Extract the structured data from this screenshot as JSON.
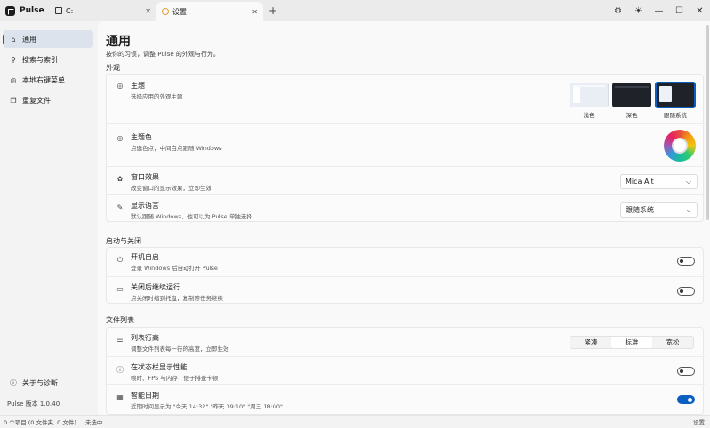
{
  "app": {
    "name": "Pulse"
  },
  "tabs": [
    {
      "label": "C:",
      "icon": "folder-icon",
      "close": "✕"
    },
    {
      "label": "设置",
      "icon": "gear-icon",
      "close": "✕"
    }
  ],
  "titlebar": {
    "new_tab": "+",
    "settings_glyph": "⚙",
    "theme_glyph": "☀",
    "min": "—",
    "max": "☐",
    "close": "✕"
  },
  "sidebar": {
    "items": [
      {
        "label": "通用",
        "glyph": "⌂",
        "active": true
      },
      {
        "label": "搜索与索引",
        "glyph": "⚲"
      },
      {
        "label": "本地右键菜单",
        "glyph": "◎"
      },
      {
        "label": "重复文件",
        "glyph": "❐"
      }
    ],
    "about": {
      "label": "关于与诊断",
      "glyph": "ⓘ"
    },
    "version": "Pulse 版本 1.0.40"
  },
  "page": {
    "title": "通用",
    "subtitle": "按你的习惯，调整 Pulse 的外观与行为。"
  },
  "sections": {
    "appearance": {
      "title": "外观",
      "theme": {
        "title": "主题",
        "desc": "选择应用的外观主题",
        "options": [
          {
            "label": "浅色"
          },
          {
            "label": "深色"
          },
          {
            "label": "跟随系统",
            "selected": true
          }
        ]
      },
      "accent": {
        "title": "主题色",
        "desc": "点选色点；中间白点跟随 Windows"
      },
      "window_effect": {
        "title": "窗口效果",
        "desc": "改变窗口的显示效果，立即生效",
        "value": "Mica Alt"
      },
      "language": {
        "title": "显示语言",
        "desc": "默认跟随 Windows，也可以为 Pulse 单独选择",
        "value": "跟随系统"
      }
    },
    "startup": {
      "title": "启动与关闭",
      "autostart": {
        "title": "开机自启",
        "desc": "登录 Windows 后自动打开 Pulse",
        "on": false
      },
      "keep_running": {
        "title": "关闭后继续运行",
        "desc": "点关闭时缩到托盘，复制等任务继续",
        "on": false
      }
    },
    "filelist": {
      "title": "文件列表",
      "row_height": {
        "title": "列表行高",
        "desc": "调整文件列表每一行的高度，立即生效",
        "options": [
          {
            "label": "紧凑"
          },
          {
            "label": "标准",
            "selected": true
          },
          {
            "label": "宽松"
          }
        ]
      },
      "perf": {
        "title": "在状态栏显示性能",
        "desc": "帧时、FPS 与内存，便于排查卡顿",
        "on": false
      },
      "smart_date": {
        "title": "智能日期",
        "desc": "近期时间显示为 \"今天 14:32\" \"昨天 09:10\" \"周三 18:00\"",
        "on": true
      }
    }
  },
  "statusbar": {
    "items": "0 个项目 (0 文件夹, 0 文件)",
    "state": "未选中",
    "right": "设置"
  }
}
